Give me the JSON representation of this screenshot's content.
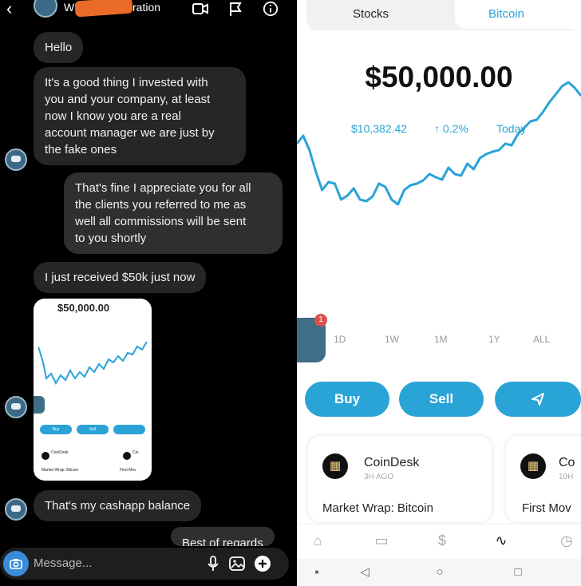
{
  "chat": {
    "header": {
      "name_start": "W",
      "name_end": "ration"
    },
    "messages": [
      {
        "from": "them",
        "text": "Hello"
      },
      {
        "from": "them",
        "lines": [
          "It's a good thing I invested with",
          "you and your company, at least",
          "now I know you are a real",
          "account manager we are just by",
          "the fake ones"
        ]
      },
      {
        "from": "me",
        "lines": [
          "That's fine I appreciate you for all",
          "the clients you referred to me as",
          "well all commissions will be sent",
          "to you shortly"
        ]
      },
      {
        "from": "them",
        "text": "I just received $50k just now"
      },
      {
        "from": "them",
        "text": "That's my cashapp balance"
      },
      {
        "from": "me",
        "text": "Best of regards"
      }
    ],
    "shared_image": {
      "price": "$50,000.00",
      "buttons": [
        "Buy",
        "Sell",
        ""
      ],
      "news": [
        {
          "source": "CoinDesk",
          "headline": "Market Wrap: Bitcoin"
        },
        {
          "source": "Coi",
          "headline": "First Mov"
        }
      ]
    },
    "composer": {
      "placeholder": "Message..."
    }
  },
  "app": {
    "tabs": [
      "Stocks",
      "Bitcoin"
    ],
    "active_tab": "Bitcoin",
    "balance": "$50,000.00",
    "btc_price": "$10,382.42",
    "change": "↑ 0.2%",
    "period": "Today",
    "ranges": [
      "1D",
      "1W",
      "1M",
      "1Y",
      "ALL"
    ],
    "notification_count": "1",
    "actions": {
      "buy": "Buy",
      "sell": "Sell"
    },
    "cards": [
      {
        "source": "CoinDesk",
        "age": "3H AGO",
        "headline": "Market Wrap: Bitcoin"
      },
      {
        "source": "Co",
        "age": "10H",
        "headline": "First Mov"
      }
    ],
    "accent": "#2aa3d6",
    "chart_points": [
      180,
      170,
      188,
      215,
      238,
      228,
      230,
      250,
      245,
      236,
      250,
      252,
      246,
      230,
      234,
      250,
      256,
      238,
      232,
      230,
      226,
      218,
      222,
      225,
      210,
      218,
      220,
      205,
      212,
      198,
      193,
      190,
      188,
      180,
      182,
      168,
      160,
      152,
      150,
      140,
      128,
      118,
      108,
      103,
      110,
      120
    ]
  }
}
